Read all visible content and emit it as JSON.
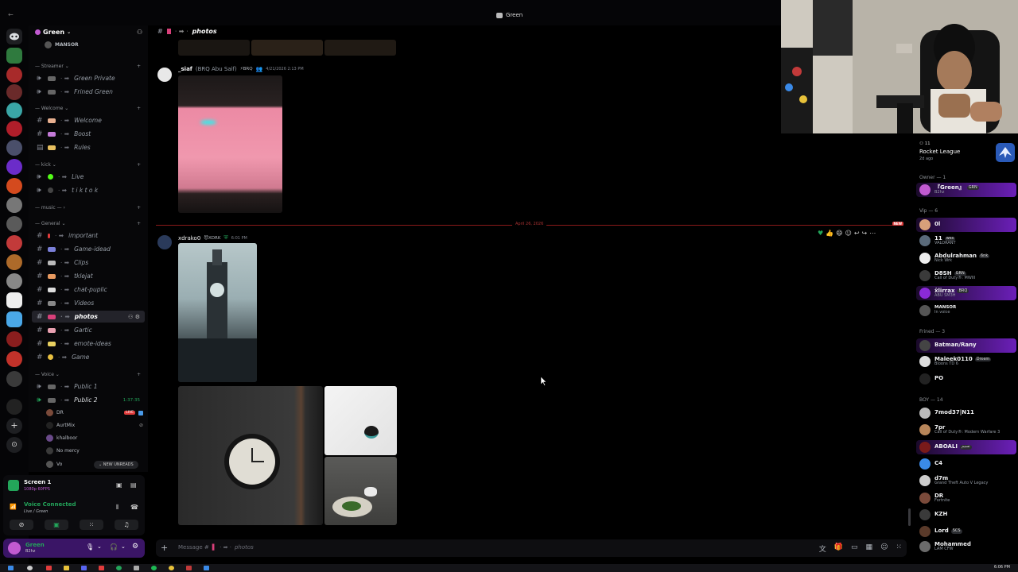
{
  "window": {
    "back_arrow": "←",
    "title": "Green"
  },
  "sidebar": {
    "server_name": "Green",
    "top_user": "MANSOR",
    "categories": [
      {
        "label": "Streamer"
      },
      {
        "label": "Welcome"
      },
      {
        "label": "kick"
      },
      {
        "label": "music"
      },
      {
        "label": "General"
      },
      {
        "label": "Voice"
      }
    ],
    "channels": [
      {
        "name": "Green Private",
        "kind": "voice"
      },
      {
        "name": "Frined Green",
        "kind": "voice"
      },
      {
        "name": "Welcome",
        "kind": "text"
      },
      {
        "name": "Boost",
        "kind": "text"
      },
      {
        "name": "Rules",
        "kind": "text"
      },
      {
        "name": "Live",
        "kind": "voice"
      },
      {
        "name": "t i k t o k",
        "kind": "voice"
      },
      {
        "name": "important",
        "kind": "text"
      },
      {
        "name": "Game-idead",
        "kind": "text"
      },
      {
        "name": "Clips",
        "kind": "text"
      },
      {
        "name": "tklejat",
        "kind": "text"
      },
      {
        "name": "chat-puplic",
        "kind": "text"
      },
      {
        "name": "Videos",
        "kind": "text"
      },
      {
        "name": "photos",
        "kind": "text",
        "active": true
      },
      {
        "name": "Gartic",
        "kind": "text"
      },
      {
        "name": "emote-ideas",
        "kind": "text"
      },
      {
        "name": "Game",
        "kind": "text"
      },
      {
        "name": "Public 1",
        "kind": "voice"
      },
      {
        "name": "Public 2",
        "kind": "voice",
        "timer": "1:37:35"
      }
    ],
    "voice_users": [
      {
        "name": "DR",
        "badge": "LIVE"
      },
      {
        "name": "AurtMix"
      },
      {
        "name": "khalboor"
      },
      {
        "name": "No mercy"
      },
      {
        "name": "Vo"
      }
    ],
    "new_unreads": "NEW UNREADS"
  },
  "stream_panel": {
    "screen_label": "Screen 1",
    "screen_sub": "1080p 60FPS",
    "voice_status": "Voice Connected",
    "voice_channel": "Live / Green"
  },
  "user_panel": {
    "name": "Green",
    "status": "B2hz"
  },
  "channel_header": {
    "name": "photos"
  },
  "messages": [
    {
      "author": "_siaf",
      "alias": "(BRQ Abu Saif)",
      "role": "BRQ",
      "time": "4/21/2026 2:13 PM"
    },
    {
      "author": "xdrako0",
      "role": "XDRK",
      "time": "6:01 PM"
    }
  ],
  "date_divider": {
    "label": "April 26, 2026",
    "new": "NEW"
  },
  "composer": {
    "placeholder_prefix": "Message #",
    "channel": "photos"
  },
  "activity": {
    "count": "11",
    "game": "Rocket League",
    "ago": "2d ago"
  },
  "member_groups": [
    {
      "label": "Owner — 1"
    },
    {
      "label": "Vip — 6"
    },
    {
      "label": "Frined — 3"
    },
    {
      "label": "BOY — 14"
    }
  ],
  "members": [
    {
      "name": "『Green』",
      "tag": "GRN",
      "status": "B2hz",
      "hl": true
    },
    {
      "name": "0l",
      "tag": "",
      "status": "",
      "hl": true
    },
    {
      "name": "11",
      "tag": "wss",
      "status": "VALORANT"
    },
    {
      "name": "Abdulrahman",
      "tag": "6nk",
      "status": "Nick Wrk"
    },
    {
      "name": "D8SH",
      "tag": "GRN",
      "status": "Call of Duty®: MWIII"
    },
    {
      "name": "x̂lirrax",
      "tag": "BRQ",
      "status": "ABU SM3H",
      "hl": true
    },
    {
      "name": "MANSOR",
      "tag": "",
      "status": "In voice"
    },
    {
      "name": "Batman/Rany",
      "tag": "",
      "status": "",
      "hl": true
    },
    {
      "name": "Maleek0110",
      "tag": "Drεem",
      "status": "Bloons TD 6"
    },
    {
      "name": "PO",
      "tag": "",
      "status": ""
    },
    {
      "name": "7mod37|N11",
      "tag": "",
      "status": ""
    },
    {
      "name": "7pr",
      "tag": "",
      "status": "Call of Duty®: Modern Warfare 3"
    },
    {
      "name": "ABOALI",
      "tag": "تسيم",
      "status": "",
      "hl": true
    },
    {
      "name": "C4",
      "tag": "",
      "status": ""
    },
    {
      "name": "d7m",
      "tag": "",
      "status": "Grand Theft Auto V Legacy"
    },
    {
      "name": "DR",
      "tag": "",
      "status": "Fortnite"
    },
    {
      "name": "KZH",
      "tag": "",
      "status": ""
    },
    {
      "name": "Lord",
      "tag": "SCS",
      "status": ""
    },
    {
      "name": "Mohammed",
      "tag": "",
      "status": "LAM CFW"
    }
  ],
  "clock": {
    "time": "6:06 PM"
  },
  "colors": {
    "accent": "#5865f2",
    "highlight": "#6b1fb8",
    "online": "#23a55a",
    "live": "#e23c3c"
  }
}
